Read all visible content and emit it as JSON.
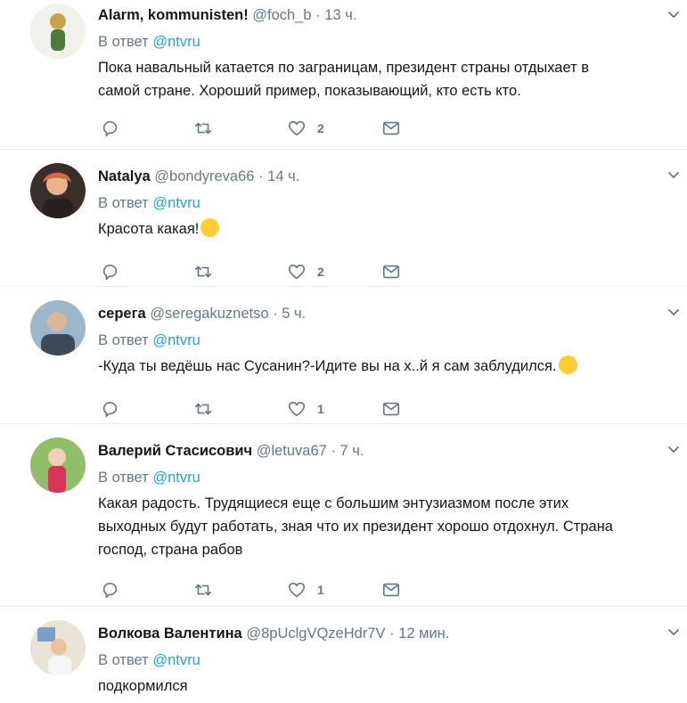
{
  "tweets": [
    {
      "name": "Alarm, kommunisten!",
      "handle": "@foch_b",
      "sep": "·",
      "time": "13 ч.",
      "reply_label": "В ответ",
      "reply_to": "@ntvru",
      "text": [
        "Пока навальный катается по заграницам, президент страны отдыхает в",
        "самой стране. Хороший пример, показывающий, кто есть кто."
      ],
      "emoji": "",
      "likes": "2",
      "avatar_colors": [
        "#f2f2ec",
        "#c9a24a",
        "#4f7a3e"
      ]
    },
    {
      "name": "Natalya",
      "handle": "@bondyreva66",
      "sep": "·",
      "time": "14 ч.",
      "reply_label": "В ответ",
      "reply_to": "@ntvru",
      "text": [
        "Красота какая!"
      ],
      "emoji": "winking-tongue-face-emoji",
      "likes": "2",
      "avatar_colors": [
        "#3a2e2a",
        "#e8b48a",
        "#d56a4a"
      ]
    },
    {
      "name": "серега",
      "handle": "@seregakuznetso",
      "sep": "·",
      "time": "5 ч.",
      "reply_label": "В ответ",
      "reply_to": "@ntvru",
      "text": [
        "-Куда ты ведёшь нас Сусанин?-Идите вы на х..й я сам заблудился."
      ],
      "emoji": "grinning-face-emoji",
      "likes": "1",
      "avatar_colors": [
        "#9db6c9",
        "#d9b89a",
        "#3d4a5a"
      ]
    },
    {
      "name": "Валерий Стасисович",
      "handle": "@letuva67",
      "sep": "·",
      "time": "7 ч.",
      "reply_label": "В ответ",
      "reply_to": "@ntvru",
      "text": [
        "Какая радость. Трудящиеся еще с большим энтузиазмом после этих",
        "выходных будут работать, зная что их президент хорошо отдохнул. Страна",
        "господ, страна рабов"
      ],
      "emoji": "",
      "likes": "1",
      "avatar_colors": [
        "#8fbf6a",
        "#f0d0b8",
        "#d8345a"
      ]
    },
    {
      "name": "Волкова Валентина",
      "handle": "@8pUclgVQzeHdr7V",
      "sep": "·",
      "time": "12 мин.",
      "reply_label": "В ответ",
      "reply_to": "@ntvru",
      "text": [
        "подкормился"
      ],
      "emoji": "",
      "likes": "",
      "avatar_colors": [
        "#e9e4d6",
        "#e8c39e",
        "#7aa0c8"
      ]
    }
  ]
}
